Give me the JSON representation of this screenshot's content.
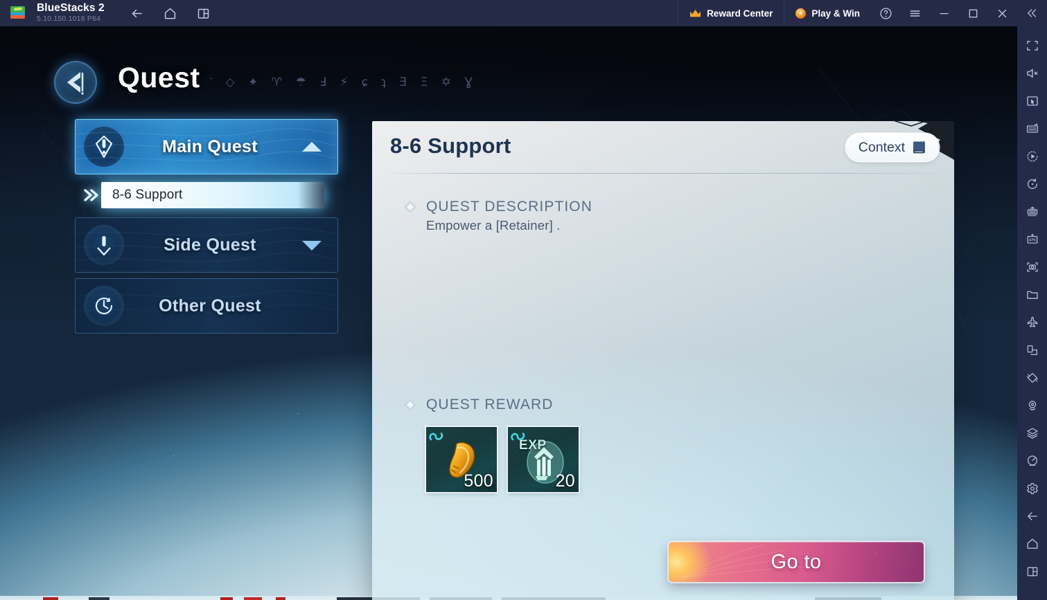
{
  "titlebar": {
    "app_name": "BlueStacks 2",
    "version": "5.10.150.1016  P64",
    "nav": [
      {
        "name": "back-icon",
        "label": "Back"
      },
      {
        "name": "home-icon",
        "label": "Home"
      },
      {
        "name": "multi-instance-icon",
        "label": "Instance Manager"
      }
    ],
    "reward_center": "Reward Center",
    "play_and_win": "Play & Win",
    "buttons": [
      {
        "name": "help-icon",
        "label": "Help"
      },
      {
        "name": "menu-icon",
        "label": "Menu"
      },
      {
        "name": "minimize-icon",
        "label": "Minimize"
      },
      {
        "name": "maximize-icon",
        "label": "Maximize"
      },
      {
        "name": "close-icon",
        "label": "Close"
      },
      {
        "name": "collapse-sidebar-icon",
        "label": "Collapse"
      }
    ]
  },
  "rail": {
    "items": [
      "fullscreen-icon",
      "mute-icon",
      "cursor-icon",
      "keymapping-icon",
      "macro-recorder-icon",
      "rotate-icon",
      "multi-instance-sync-icon",
      "install-apk-icon",
      "screenshot-icon",
      "media-folder-icon",
      "airplane-mode-icon",
      "resize-window-icon",
      "shake-icon",
      "location-icon",
      "layers-icon",
      "performance-icon",
      "settings-gear-icon",
      "android-back-icon",
      "android-home-icon",
      "android-recents-icon"
    ]
  },
  "game": {
    "header": {
      "title": "Quest",
      "runes": "་ ◇ ✦ ♈ ☂ Ⅎ ⚡   ɕ ʇ Ǝ Ξ ✡ Ɣ",
      "emblem": "quest-emblem-icon"
    },
    "categories": [
      {
        "label": "Main Quest",
        "icon": "main-quest-icon",
        "state": "active",
        "chevron": "up"
      },
      {
        "label": "Side Quest",
        "icon": "side-quest-icon",
        "state": "inactive",
        "chevron": "down"
      },
      {
        "label": "Other Quest",
        "icon": "other-quest-icon",
        "state": "inactive",
        "chevron": "none"
      }
    ],
    "selected_quest": "8-6 Support",
    "panel": {
      "title": "8-6 Support",
      "context_label": "Context",
      "description_heading": "QUEST DESCRIPTION",
      "description_text": "Empower a  [Retainer] .",
      "reward_heading": "QUEST REWARD",
      "rewards": [
        {
          "name": "fang-item",
          "count": "500",
          "label": ""
        },
        {
          "name": "exp-item",
          "count": "20",
          "label": "EXP"
        }
      ],
      "goto_label": "Go to"
    }
  },
  "colors": {
    "titlebar_bg": "#252b47",
    "rail_bg": "#232a4a",
    "accent_blue": "#2e8ccd",
    "panel_title": "#1d3350",
    "section_title": "#5a6f86",
    "goto_pink": "#d85b8d",
    "goto_yellow": "#ffc45f"
  }
}
